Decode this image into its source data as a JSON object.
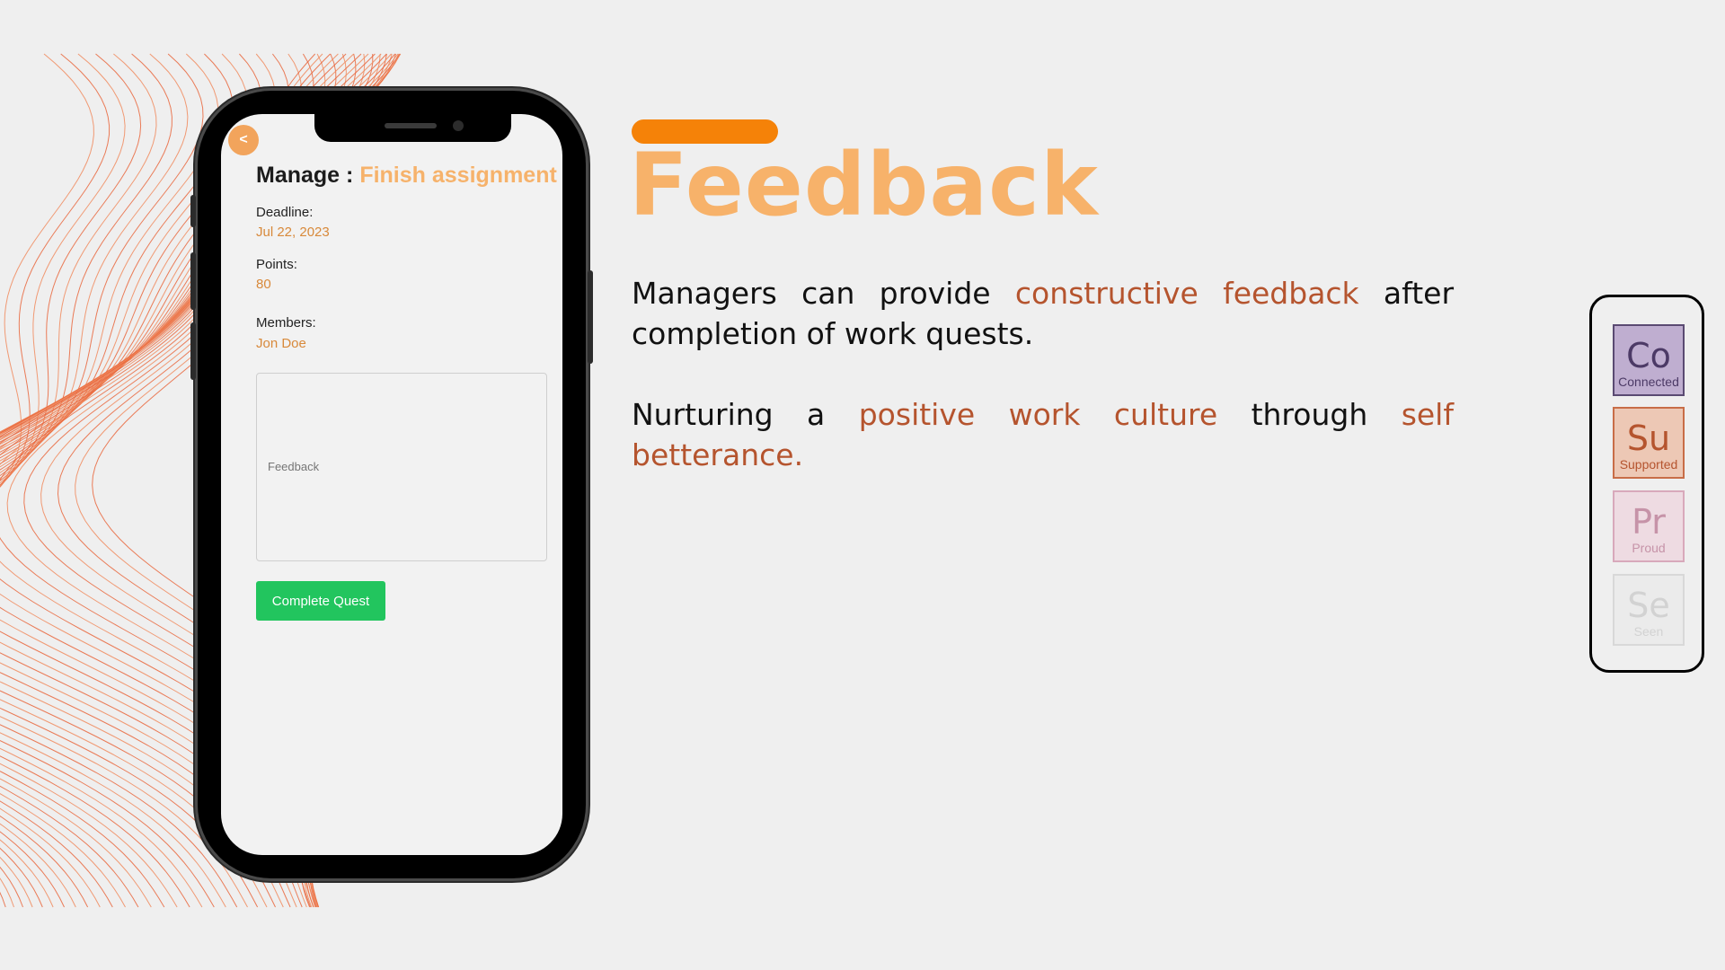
{
  "phone_screen": {
    "back_button": "<",
    "title_prefix": "Manage :",
    "task_name": "Finish assignment",
    "fields": [
      {
        "label": "Deadline:",
        "value": "Jul 22, 2023"
      },
      {
        "label": "Points:",
        "value": "80"
      },
      {
        "label": "Members:",
        "value": "Jon Doe"
      }
    ],
    "feedback_placeholder": "Feedback",
    "complete_button": "Complete Quest"
  },
  "slide": {
    "heading": "Feedback",
    "paragraph1": {
      "part1": "Managers can provide ",
      "highlight1": "constructive feedback",
      "part2": " after completion of work quests."
    },
    "paragraph2": {
      "part1": "Nurturing a ",
      "highlight1": "positive work culture",
      "part2": " through ",
      "highlight2": "self betterance."
    }
  },
  "elements": [
    {
      "symbol": "Co",
      "name": "Connected",
      "bg": "#bfaed0",
      "border": "#5a4a72",
      "color": "#4c3a66"
    },
    {
      "symbol": "Su",
      "name": "Supported",
      "bg": "#edc8b5",
      "border": "#c86d47",
      "color": "#b5542e"
    },
    {
      "symbol": "Pr",
      "name": "Proud",
      "bg": "#eedbe2",
      "border": "#d8a9bb",
      "color": "#c693a8"
    },
    {
      "symbol": "Se",
      "name": "Seen",
      "bg": "#ebebeb",
      "border": "#d8d8d8",
      "color": "#d2d2d2"
    }
  ],
  "colors": {
    "accent_orange": "#f58208",
    "heading_orange": "#f7b26a",
    "highlight_rust": "#b5542e",
    "button_green": "#22c55e"
  }
}
